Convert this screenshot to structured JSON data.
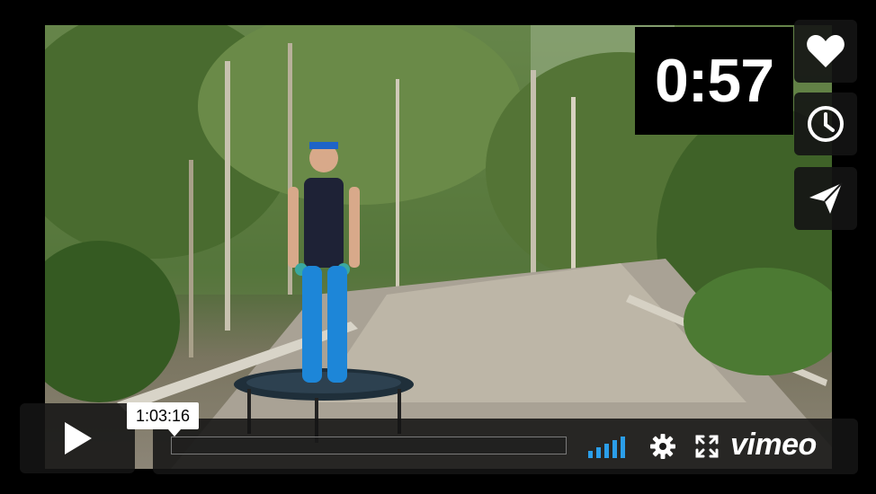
{
  "player": {
    "timer_text": "0:57",
    "timecode": "1:03:16",
    "brand": "vimeo",
    "progress": 0.0,
    "volume_level_bars": 5,
    "accent_color": "#2b9ee9"
  },
  "side_buttons": [
    {
      "icon": "heart-icon"
    },
    {
      "icon": "clock-icon"
    },
    {
      "icon": "send-icon"
    }
  ],
  "controls": {
    "play_icon": "play-icon",
    "settings_icon": "gear-icon",
    "fullscreen_icon": "fullscreen-icon"
  }
}
